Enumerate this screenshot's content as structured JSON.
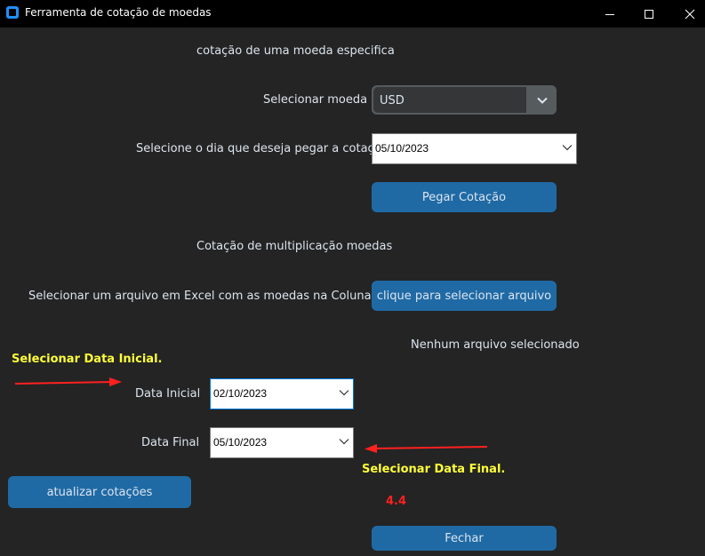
{
  "window": {
    "title": "Ferramenta de cotação de moedas"
  },
  "single": {
    "heading": "cotação de uma moeda especifica",
    "currency_label": "Selecionar moeda",
    "currency_value": "USD",
    "day_label": "Selecione o dia que deseja pegar a cotação",
    "day_value": "05/10/2023",
    "get_quote_button": "Pegar Cotação"
  },
  "multi": {
    "heading": "Cotação de multiplicação moedas",
    "file_label": "Selecionar um arquivo em Excel com as moedas na Coluna A",
    "file_button": "clique para selecionar arquivo",
    "file_status": "Nenhum arquivo selecionado",
    "start_label": "Data Inicial",
    "start_value": "02/10/2023",
    "end_label": "Data Final",
    "end_value": "05/10/2023",
    "update_button": "atualizar cotações",
    "close_button": "Fechar"
  },
  "annotations": {
    "start_note": "Selecionar Data Inicial.",
    "end_note": "Selecionar Data Final.",
    "version": "4.4"
  },
  "colors": {
    "background": "#242424",
    "button": "#1f6aa5",
    "annotation_yellow": "#ffff3a",
    "annotation_red": "#ff2020"
  }
}
